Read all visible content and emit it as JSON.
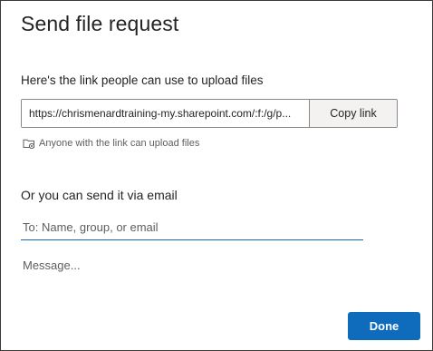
{
  "dialog": {
    "title": "Send file request",
    "link_section_label": "Here's the link people can use to upload files",
    "link_url": "https://chrismenardtraining-my.sharepoint.com/:f:/g/p...",
    "copy_link_label": "Copy link",
    "permission_icon": "folder-link-icon",
    "permission_text": "Anyone with the link can upload files",
    "email_section_label": "Or you can send it via email",
    "to_placeholder": "To: Name, group, or email",
    "message_placeholder": "Message...",
    "done_label": "Done"
  },
  "colors": {
    "accent": "#0f6cbd",
    "text": "#252423",
    "secondary_text": "#605e5c",
    "border": "#8a8886",
    "button_bg": "#f3f2f1"
  }
}
